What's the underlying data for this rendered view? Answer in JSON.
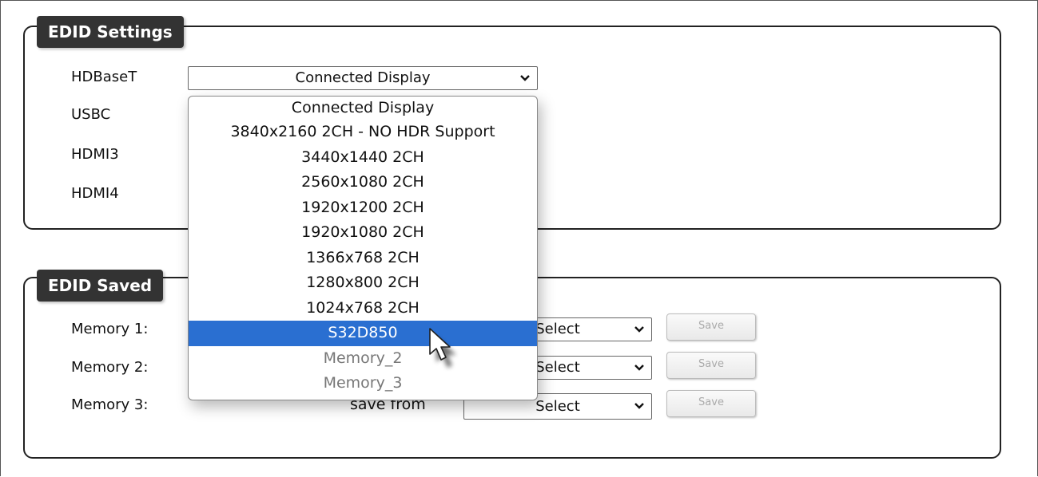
{
  "edid_settings": {
    "title": "EDID Settings",
    "rows": [
      {
        "label": "HDBaseT",
        "value": "Connected Display"
      },
      {
        "label": "USBC"
      },
      {
        "label": "HDMI3"
      },
      {
        "label": "HDMI4"
      }
    ]
  },
  "dropdown": {
    "options": [
      "Connected Display",
      "3840x2160 2CH - NO HDR Support",
      "3440x1440 2CH",
      "2560x1080 2CH",
      "1920x1200 2CH",
      "1920x1080 2CH",
      "1366x768 2CH",
      "1280x800 2CH",
      "1024x768 2CH",
      "S32D850",
      "Memory_2",
      "Memory_3"
    ],
    "highlighted": "S32D850",
    "disabled": [
      "Memory_2",
      "Memory_3"
    ]
  },
  "edid_saved": {
    "title": "EDID Saved",
    "rows": [
      {
        "label": "Memory 1:",
        "select_value": "Select",
        "save_label": "Save"
      },
      {
        "label": "Memory 2:",
        "select_value": "Select",
        "save_label": "Save"
      },
      {
        "label": "Memory 3:",
        "save_from_label": "save from",
        "select_value": "Select",
        "save_label": "Save"
      }
    ]
  },
  "icons": {
    "dropdown_arrow": "chevron-down-icon",
    "cursor": "mouse-pointer-icon"
  }
}
